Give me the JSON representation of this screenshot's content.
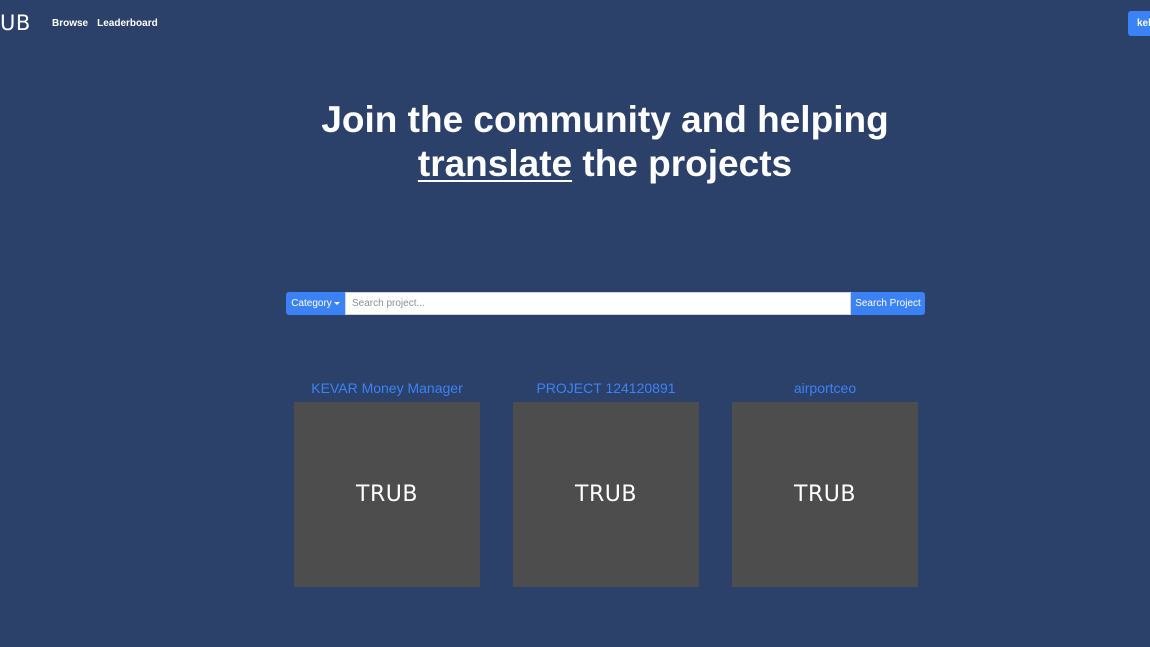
{
  "navbar": {
    "brand": "UB",
    "links": [
      "Browse",
      "Leaderboard"
    ],
    "user_button": "kel"
  },
  "hero": {
    "line1": "Join the community and helping",
    "underlined_word": "translate",
    "line2_rest": " the projects"
  },
  "search": {
    "category_label": "Category",
    "placeholder": "Search project...",
    "value": "",
    "button_label": "Search Project"
  },
  "projects": [
    {
      "title": "KEVAR Money Manager",
      "thumb_text": "TRUB"
    },
    {
      "title": "PROJECT 124120891",
      "thumb_text": "TRUB"
    },
    {
      "title": "airportceo",
      "thumb_text": "TRUB"
    }
  ],
  "colors": {
    "background": "#2c4169",
    "accent": "#3b82f6",
    "thumbnail": "#4d4d4d"
  }
}
